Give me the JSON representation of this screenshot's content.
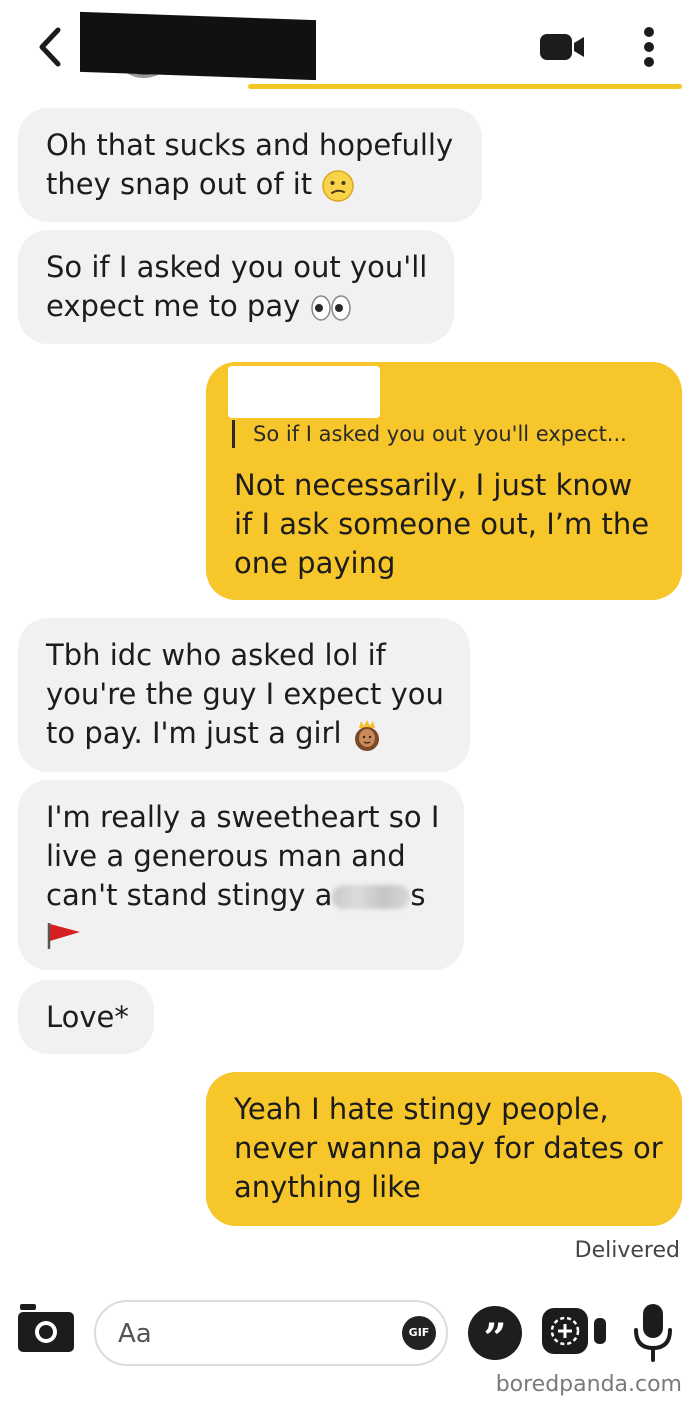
{
  "header": {
    "icons": {
      "back": "chevron-left-icon",
      "video": "video-camera-icon",
      "more": "more-vertical-icon"
    },
    "accent_color": "#f3c623"
  },
  "messages": [
    {
      "direction": "received",
      "lines": [
        "Oh that sucks and hopefully",
        "they snap out of it"
      ],
      "emoji": "confused-face"
    },
    {
      "direction": "received",
      "lines": [
        "So if I asked you out you'll",
        "expect me to pay"
      ],
      "emoji": "eyes"
    },
    {
      "direction": "sent",
      "reply_quote": "So if I asked you out you'll expect...",
      "lines": [
        "Not necessarily, I just know",
        "if I ask someone out, I’m the",
        "one paying"
      ]
    },
    {
      "direction": "received",
      "lines": [
        "Tbh idc who asked lol if",
        "you're the guy I expect you",
        "to pay. I'm just a girl"
      ],
      "emoji": "princess"
    },
    {
      "direction": "received",
      "lines": [
        "I'm really a sweetheart so I",
        "live a generous man and"
      ],
      "line3_prefix": "can't stand stingy a",
      "line3_suffix": "s",
      "emoji": "red-flag"
    },
    {
      "direction": "received",
      "lines": [
        "Love*"
      ]
    },
    {
      "direction": "sent",
      "lines": [
        "Yeah I hate stingy people,",
        "never wanna pay for dates or",
        "anything like"
      ]
    }
  ],
  "status": {
    "delivered": "Delivered"
  },
  "composer": {
    "placeholder": "Aa",
    "gif_label": "GIF",
    "quote_label": "”",
    "icons": {
      "camera": "camera-icon",
      "gif": "gif-icon",
      "quote": "quote-icon",
      "sticker": "sticker-icon",
      "mic": "microphone-icon"
    }
  },
  "colors": {
    "sent_bubble": "#f7c62a",
    "received_bubble": "#f1f1f1"
  },
  "watermark": "boredpanda.com"
}
